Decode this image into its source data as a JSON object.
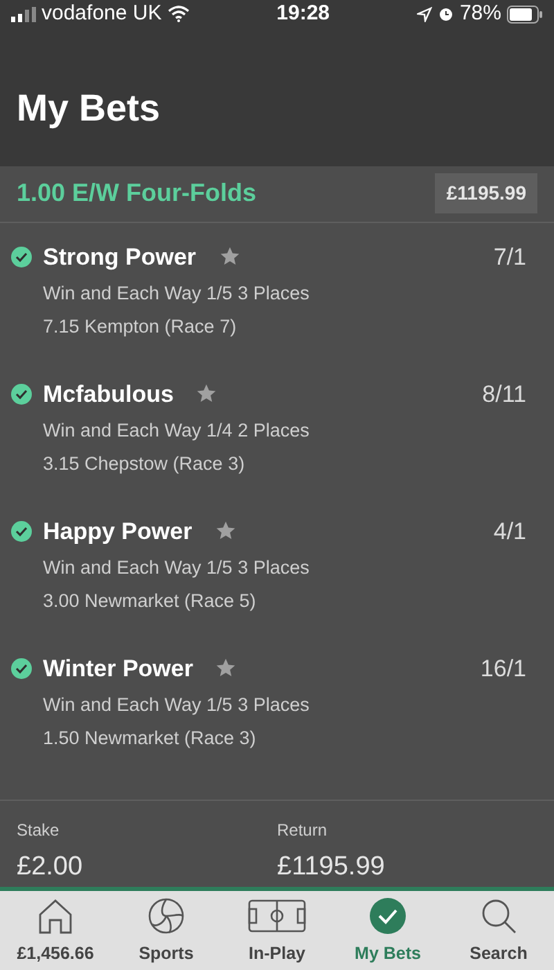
{
  "status_bar": {
    "carrier": "vodafone UK",
    "time": "19:28",
    "battery": "78%"
  },
  "header": {
    "title": "My Bets"
  },
  "bet": {
    "title": "1.00 E/W Four-Folds",
    "return_amount": "£1195.99"
  },
  "selections": [
    {
      "name": "Strong Power",
      "won": true,
      "starred": false,
      "odds": "7/1",
      "market": "Win and Each Way 1/5 3 Places",
      "race": "7.15 Kempton (Race 7)"
    },
    {
      "name": "Mcfabulous",
      "won": true,
      "starred": false,
      "odds": "8/11",
      "market": "Win and Each Way 1/4 2 Places",
      "race": "3.15 Chepstow (Race 3)"
    },
    {
      "name": "Happy Power",
      "won": true,
      "starred": false,
      "odds": "4/1",
      "market": "Win and Each Way 1/5 3 Places",
      "race": "3.00 Newmarket (Race 5)"
    },
    {
      "name": "Winter Power",
      "won": true,
      "starred": false,
      "odds": "16/1",
      "market": "Win and Each Way 1/5 3 Places",
      "race": "1.50 Newmarket (Race 3)"
    }
  ],
  "totals": {
    "stake_label": "Stake",
    "stake": "£2.00",
    "return_label": "Return",
    "return": "£1195.99"
  },
  "tabs": [
    {
      "kind": "home",
      "label": "£1,456.66",
      "selected": false
    },
    {
      "kind": "sports",
      "label": "Sports",
      "selected": false
    },
    {
      "kind": "inplay",
      "label": "In-Play",
      "selected": false
    },
    {
      "kind": "mybets",
      "label": "My Bets",
      "selected": true
    },
    {
      "kind": "search",
      "label": "Search",
      "selected": false
    }
  ]
}
